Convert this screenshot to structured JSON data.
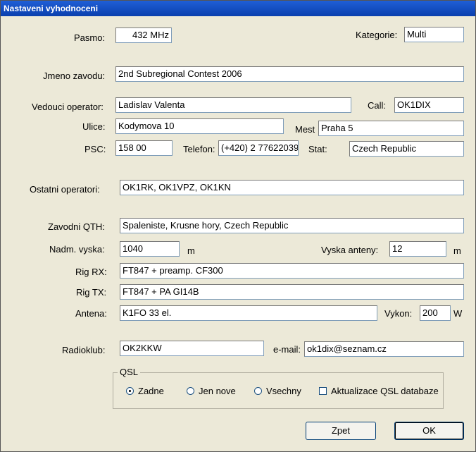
{
  "window": {
    "title": "Nastaveni vyhodnoceni"
  },
  "form": {
    "pasmo": {
      "label": "Pasmo:",
      "value": "432 MHz"
    },
    "kategorie": {
      "label": "Kategorie:",
      "value": "Multi"
    },
    "jmeno_zavodu": {
      "label": "Jmeno zavodu:",
      "value": "2nd Subregional Contest 2006"
    },
    "vedouci_operator": {
      "label": "Vedouci operator:",
      "value": "Ladislav Valenta"
    },
    "call": {
      "label": "Call:",
      "value": "OK1DIX"
    },
    "ulice": {
      "label": "Ulice:",
      "value": "Kodymova 10"
    },
    "mest": {
      "label": "Mest",
      "value": "Praha 5"
    },
    "psc": {
      "label": "PSC:",
      "value": "158 00"
    },
    "telefon": {
      "label": "Telefon:",
      "value": "(+420) 2 77622039"
    },
    "stat": {
      "label": "Stat:",
      "value": "Czech Republic"
    },
    "ostatni_operatori": {
      "label": "Ostatni operatori:",
      "value": "OK1RK, OK1VPZ, OK1KN"
    },
    "zavodni_qth": {
      "label": "Zavodni QTH:",
      "value": "Spaleniste, Krusne hory, Czech Republic"
    },
    "nadm_vyska": {
      "label": "Nadm. vyska:",
      "value": "1040",
      "unit": "m"
    },
    "vyska_anteny": {
      "label": "Vyska anteny:",
      "value": "12",
      "unit": "m"
    },
    "rig_rx": {
      "label": "Rig RX:",
      "value": "FT847 + preamp. CF300"
    },
    "rig_tx": {
      "label": "Rig TX:",
      "value": "FT847 + PA GI14B"
    },
    "antena": {
      "label": "Antena:",
      "value": "K1FO 33 el."
    },
    "vykon": {
      "label": "Vykon:",
      "value": "200",
      "unit": "W"
    },
    "radioklub": {
      "label": "Radioklub:",
      "value": "OK2KKW"
    },
    "email": {
      "label": "e-mail:",
      "value": "ok1dix@seznam.cz"
    }
  },
  "qsl": {
    "legend": "QSL",
    "options": [
      "Zadne",
      "Jen nove",
      "Vsechny"
    ],
    "selected": "Zadne",
    "checkbox_label": "Aktualizace QSL databaze",
    "checkbox_checked": false
  },
  "buttons": {
    "back": "Zpet",
    "ok": "OK"
  }
}
